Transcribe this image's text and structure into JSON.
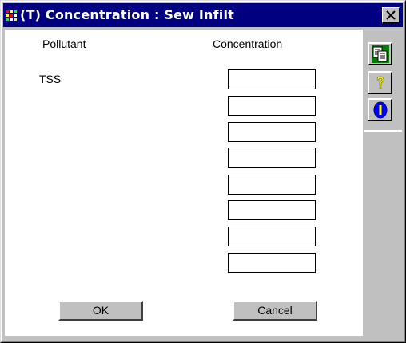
{
  "window": {
    "title": "(T) Concentration : Sew Infilt"
  },
  "headers": {
    "pollutant": "Pollutant",
    "concentration": "Concentration"
  },
  "pollutants": [
    {
      "name": "TSS",
      "concentration": ""
    }
  ],
  "concentration_fields": [
    "",
    "",
    "",
    "",
    "",
    "",
    "",
    ""
  ],
  "buttons": {
    "ok": "OK",
    "cancel": "Cancel"
  },
  "toolbar": {
    "icons": [
      "copy-icon",
      "help-icon",
      "info-icon"
    ]
  },
  "colors": {
    "titlebar": "#000080",
    "face": "#c0c0c0",
    "client": "#ffffff"
  }
}
